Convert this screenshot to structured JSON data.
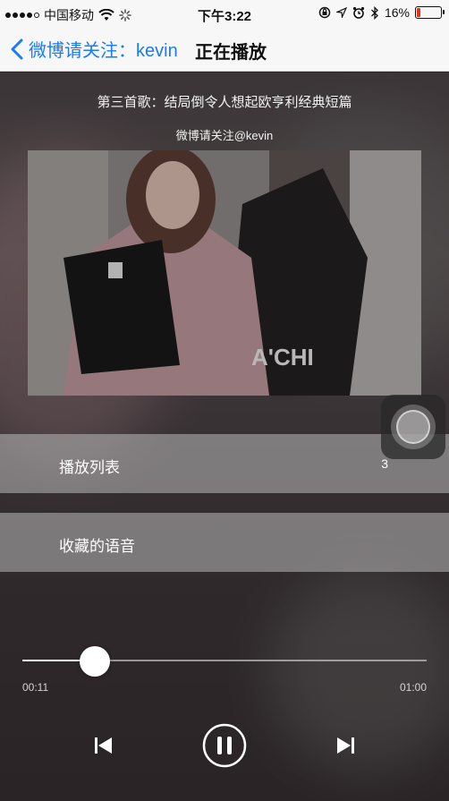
{
  "status_bar": {
    "carrier": "中国移动",
    "time": "下午3:22",
    "battery_percent": "16%",
    "battery_level": 0.16
  },
  "nav": {
    "back_label": "微博请关注：kevin",
    "title": "正在播放"
  },
  "player": {
    "song_title": "第三首歌：结局倒令人想起欧亨利经典短篇",
    "author": "微博请关注@kevin",
    "playlist_label": "播放列表",
    "playlist_count": "3",
    "favorites_label": "收藏的语音",
    "elapsed": "00:11",
    "duration": "01:00",
    "progress": 0.18
  },
  "colors": {
    "accent": "#1a7bf2",
    "battery_low": "#e0341e"
  }
}
